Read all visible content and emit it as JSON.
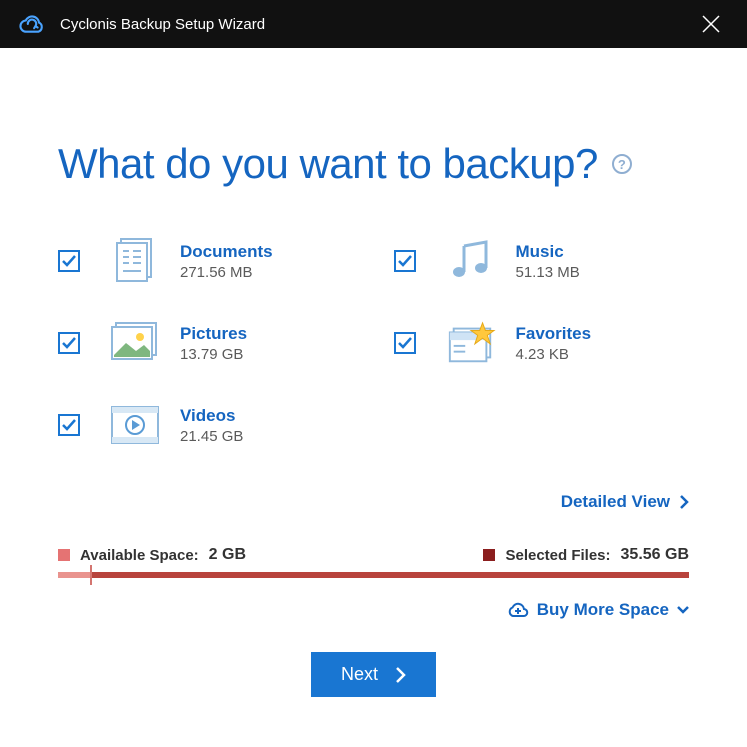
{
  "window": {
    "title": "Cyclonis Backup Setup Wizard"
  },
  "heading": "What do you want to backup?",
  "categories": [
    {
      "name": "Documents",
      "size": "271.56 MB"
    },
    {
      "name": "Music",
      "size": "51.13 MB"
    },
    {
      "name": "Pictures",
      "size": "13.79 GB"
    },
    {
      "name": "Favorites",
      "size": "4.23 KB"
    },
    {
      "name": "Videos",
      "size": "21.45 GB"
    }
  ],
  "detailed_view_label": "Detailed View",
  "space": {
    "available_label": "Available Space:",
    "available_value": "2 GB",
    "selected_label": "Selected Files:",
    "selected_value": "35.56 GB"
  },
  "buy_more_label": "Buy More Space",
  "next_label": "Next"
}
